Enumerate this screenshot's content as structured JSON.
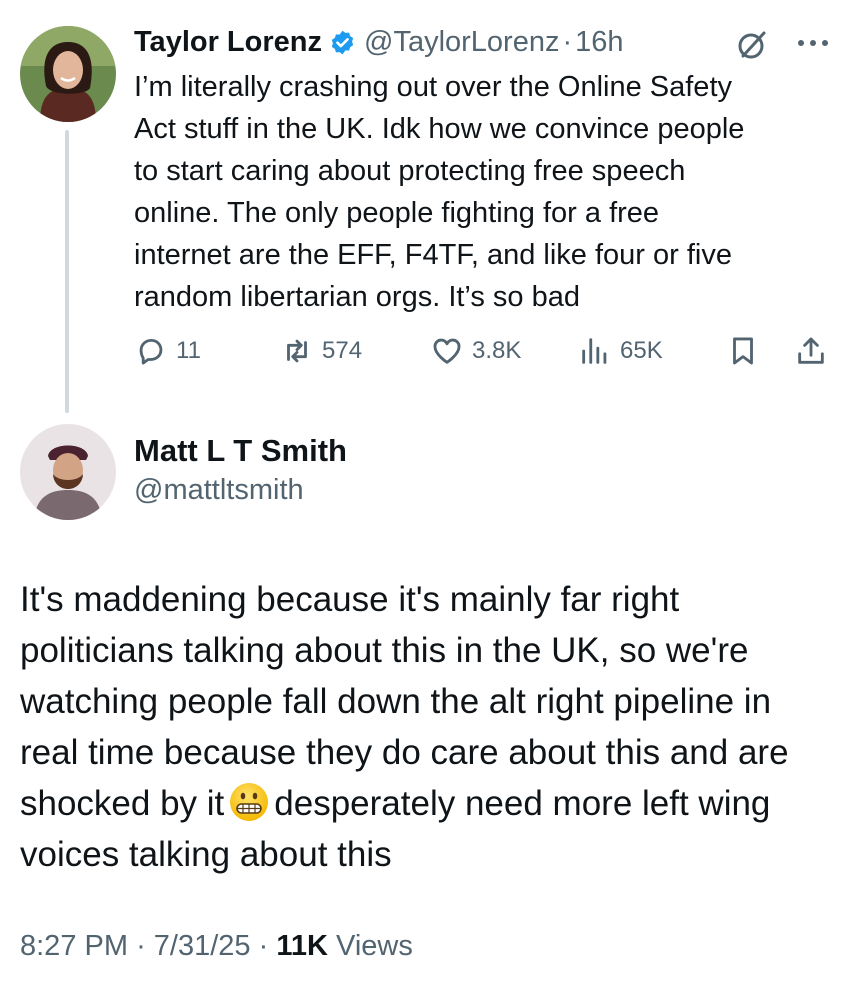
{
  "tweet1": {
    "author_name": "Taylor Lorenz",
    "handle": "@TaylorLorenz",
    "separator": "·",
    "time": "16h",
    "avatar_icon": "profile-photo-taylor",
    "verified_color": "#1d9bf0",
    "text": "I’m literally crashing out over the Online Safety\nAct stuff in the UK. Idk how we convince people\nto start caring about protecting free speech\nonline. The only people fighting for a free\ninternet are the EFF, F4TF, and like four or five\nrandom libertarian orgs. It’s so bad",
    "replies": "11",
    "reposts": "574",
    "likes": "3.8K",
    "views": "65K"
  },
  "tweet2": {
    "author_name": "Matt L T Smith",
    "handle": "@mattltsmith",
    "avatar_icon": "profile-photo-matt",
    "text_before_emoji": "It's maddening because it's mainly far right\npoliticians talking about this in the UK, so we're\nwatching people fall down the alt right pipeline in\nreal time because they do care about this and are\nshocked by it",
    "emoji": "grimacing-face-emoji",
    "text_after_emoji": "desperately need more left wing\nvoices talking about this",
    "time": "8:27 PM",
    "date": "7/31/25",
    "separator": "·",
    "views_count": "11K",
    "views_label": "Views"
  },
  "colors": {
    "text": "#0f1419",
    "secondary": "#536471",
    "thread_line": "#cfd9de"
  }
}
